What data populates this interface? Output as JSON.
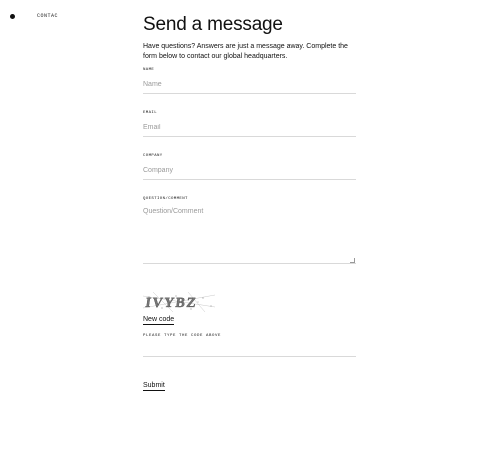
{
  "nav": {
    "breadcrumb": "CONTAC"
  },
  "page": {
    "title": "Send a message",
    "intro": "Have questions? Answers are just a message away. Complete the form below to contact our global headquarters."
  },
  "form": {
    "name": {
      "label": "NAME",
      "placeholder": "Name"
    },
    "email": {
      "label": "EMAIL",
      "placeholder": "Email"
    },
    "company": {
      "label": "COMPANY",
      "placeholder": "Company"
    },
    "question": {
      "label": "QUESTION/COMMENT",
      "placeholder": "Question/Comment"
    },
    "captcha": {
      "image_text": "IVYBZ",
      "new_code_label": "New code",
      "input_label": "PLEASE TYPE THE CODE ABOVE"
    },
    "submit_label": "Submit"
  }
}
